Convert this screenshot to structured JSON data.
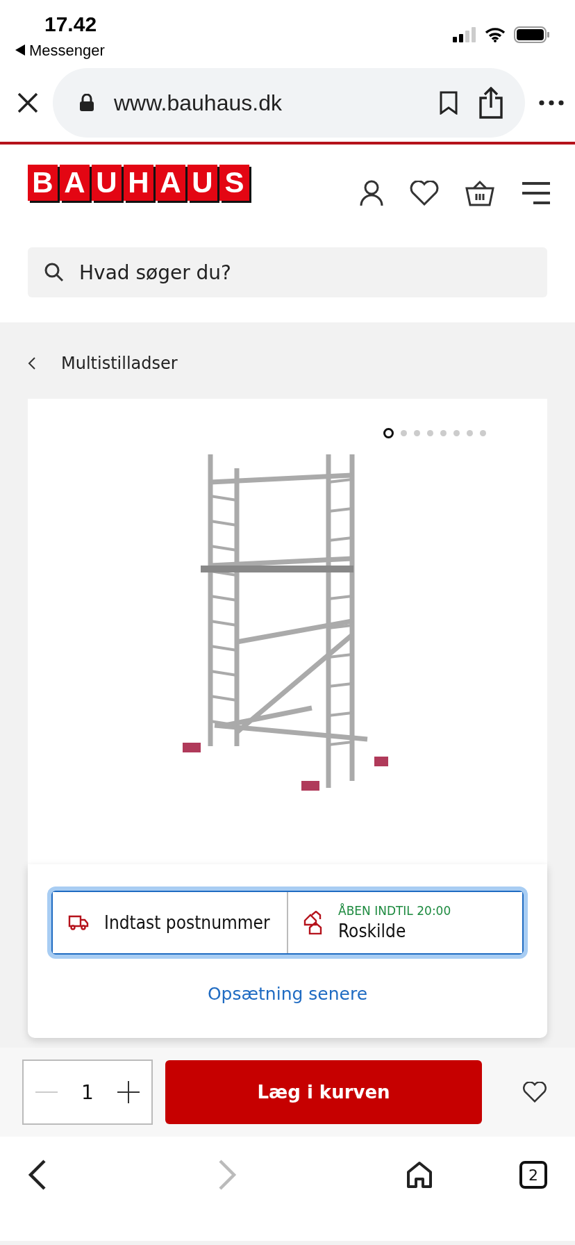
{
  "status_bar": {
    "time": "17.42",
    "back_app": "Messenger"
  },
  "browser": {
    "url": "www.bauhaus.dk",
    "tab_count": "2"
  },
  "header": {
    "logo_letters": [
      "B",
      "A",
      "U",
      "H",
      "A",
      "U",
      "S"
    ]
  },
  "search": {
    "placeholder": "Hvad søger du?"
  },
  "breadcrumb": {
    "label": "Multistilladser"
  },
  "gallery": {
    "dots": [
      {
        "selected": true
      },
      {
        "selected": false
      },
      {
        "selected": false
      },
      {
        "selected": false
      },
      {
        "selected": false
      },
      {
        "selected": false
      },
      {
        "selected": false
      },
      {
        "selected": false
      }
    ]
  },
  "store_prompt": {
    "delivery": "Indtast postnummer",
    "store_status": "ÅBEN INDTIL 20:00",
    "store": "Roskilde",
    "later_link": "Opsætning senere"
  },
  "cart_bar": {
    "quantity": "1",
    "add_button": "Læg i kurven"
  }
}
